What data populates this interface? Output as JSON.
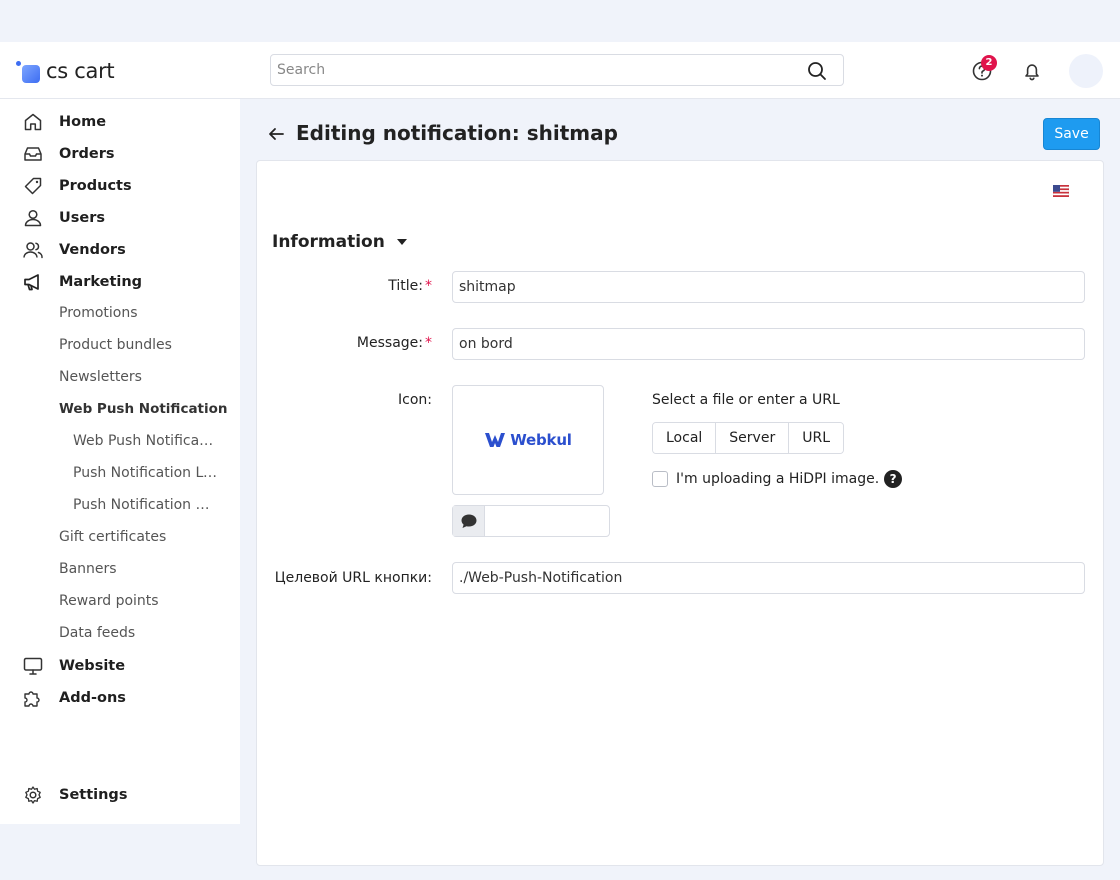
{
  "app": {
    "logo_text": "cs cart"
  },
  "header": {
    "search_placeholder": "Search",
    "help_badge_count": "2"
  },
  "sidebar": {
    "items": [
      {
        "label": "Home",
        "icon": "home-icon"
      },
      {
        "label": "Orders",
        "icon": "inbox-icon"
      },
      {
        "label": "Products",
        "icon": "tag-icon"
      },
      {
        "label": "Users",
        "icon": "user-icon"
      },
      {
        "label": "Vendors",
        "icon": "users-icon"
      },
      {
        "label": "Marketing",
        "icon": "megaphone-icon"
      }
    ],
    "marketing_sub": [
      "Promotions",
      "Product bundles",
      "Newsletters",
      "Web Push Notification"
    ],
    "web_push_sub": [
      "Web Push Notification",
      "Push Notification Log",
      "Push Notification Subscribers"
    ],
    "marketing_sub_rest": [
      "Gift certificates",
      "Banners",
      "Reward points",
      "Data feeds"
    ],
    "bottom_items": [
      {
        "label": "Website",
        "icon": "monitor-icon"
      },
      {
        "label": "Add-ons",
        "icon": "puzzle-icon"
      }
    ],
    "settings": {
      "label": "Settings",
      "icon": "gear-icon"
    }
  },
  "page": {
    "title": "Editing notification: shitmap",
    "save_label": "Save",
    "language_flag": "us-flag-icon"
  },
  "form": {
    "section_title": "Information",
    "title_label": "Title:",
    "title_value": "shitmap",
    "message_label": "Message:",
    "message_value": "on bord",
    "icon_label": "Icon:",
    "icon_image_text": "Webkul",
    "file_hint": "Select a file or enter a URL",
    "source_buttons": [
      "Local",
      "Server",
      "URL"
    ],
    "hidpi_label": "I'm uploading a HiDPI image.",
    "hidpi_checked": false,
    "url_label": "Целевой URL кнопки:",
    "url_value": "./Web-Push-Notification",
    "required_mark": "*"
  },
  "colors": {
    "accent": "#1e9bf0",
    "badge": "#e0144c",
    "brand_blue": "#2b4fce"
  }
}
